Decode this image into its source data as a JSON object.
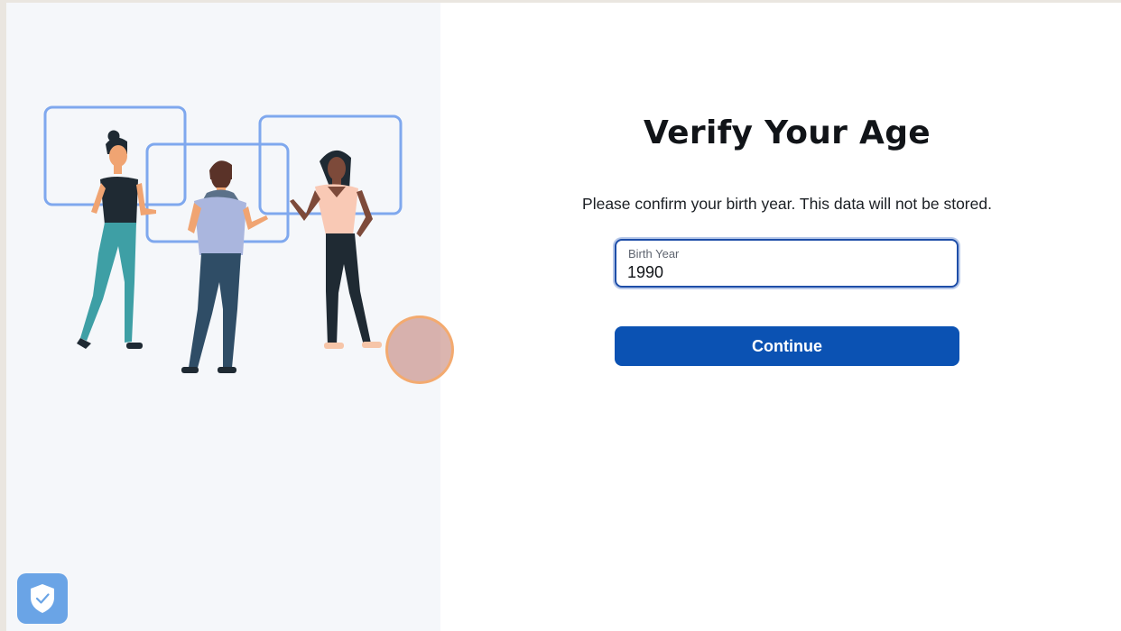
{
  "page": {
    "title": "Verify Your Age",
    "subtitle": "Please confirm your birth year. This data will not be stored."
  },
  "form": {
    "birth_year_label": "Birth Year",
    "birth_year_value": "1990",
    "continue_label": "Continue"
  },
  "illustration": {
    "name": "people-with-video-frames-illustration",
    "colors": {
      "frame_stroke": "#7fa8ee",
      "skin": "#f0a472",
      "hair_dark": "#1f2a33",
      "shirt_dark": "#1f2a33",
      "pants_teal": "#3e9fa5",
      "shirt_lavender": "#aab6de",
      "pants_navy": "#2f4d66",
      "hair_brown": "#5a3228",
      "shirt_peach": "#f9c9b5"
    }
  },
  "badge": {
    "icon": "shield-check-icon",
    "color": "#6aa4e6"
  },
  "colors": {
    "primary_button": "#0b52b3",
    "input_border": "#1e4ea8",
    "left_panel_bg": "#f5f7fa",
    "click_indicator": "#f6aa68"
  }
}
